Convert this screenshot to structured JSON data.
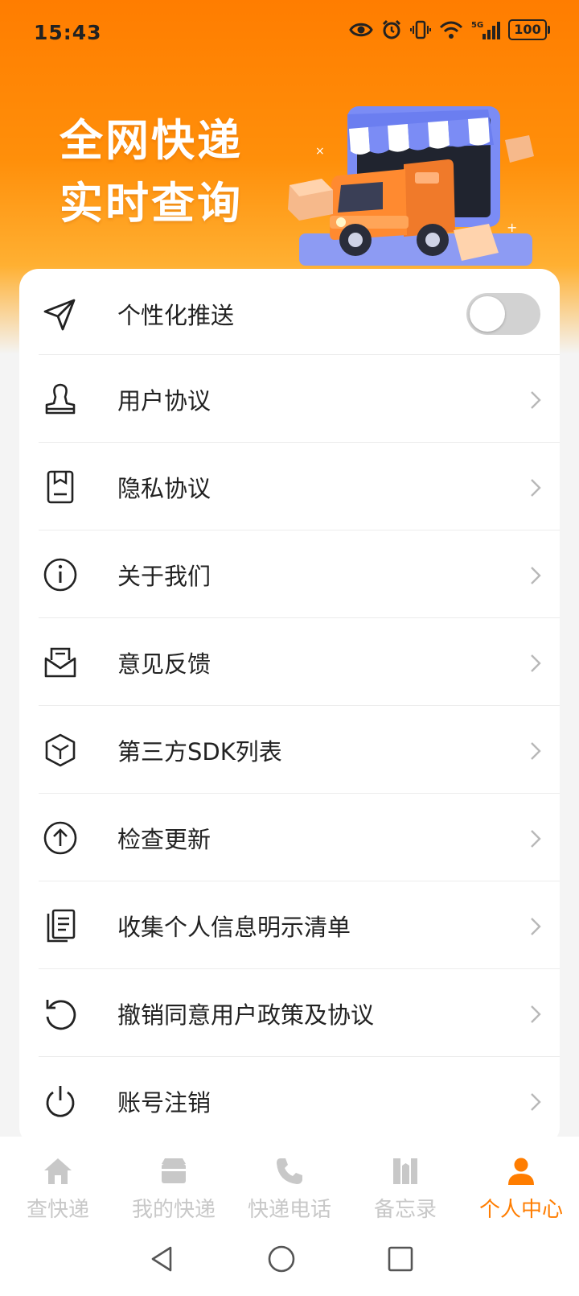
{
  "status_bar": {
    "time": "15:43",
    "battery": "100"
  },
  "hero": {
    "line1": "全网快递",
    "line2": "实时查询"
  },
  "menu": {
    "push": {
      "label": "个性化推送",
      "enabled": false
    },
    "items": [
      {
        "label": "用户协议",
        "icon": "user-stamp-icon"
      },
      {
        "label": "隐私协议",
        "icon": "privacy-doc-icon"
      },
      {
        "label": "关于我们",
        "icon": "info-icon"
      },
      {
        "label": "意见反馈",
        "icon": "feedback-mail-icon"
      },
      {
        "label": "第三方SDK列表",
        "icon": "cube-icon"
      },
      {
        "label": "检查更新",
        "icon": "upload-circle-icon"
      },
      {
        "label": "收集个人信息明示清单",
        "icon": "document-list-icon"
      },
      {
        "label": "撤销同意用户政策及协议",
        "icon": "revoke-icon"
      },
      {
        "label": "账号注销",
        "icon": "power-icon"
      }
    ]
  },
  "tabs": [
    {
      "label": "查快递",
      "icon": "home-icon"
    },
    {
      "label": "我的快递",
      "icon": "package-icon"
    },
    {
      "label": "快递电话",
      "icon": "phone-icon"
    },
    {
      "label": "备忘录",
      "icon": "memo-icon"
    },
    {
      "label": "个人中心",
      "icon": "person-icon",
      "active": true
    }
  ],
  "colors": {
    "accent": "#ff7d00",
    "inactive": "#c8c8c8"
  }
}
